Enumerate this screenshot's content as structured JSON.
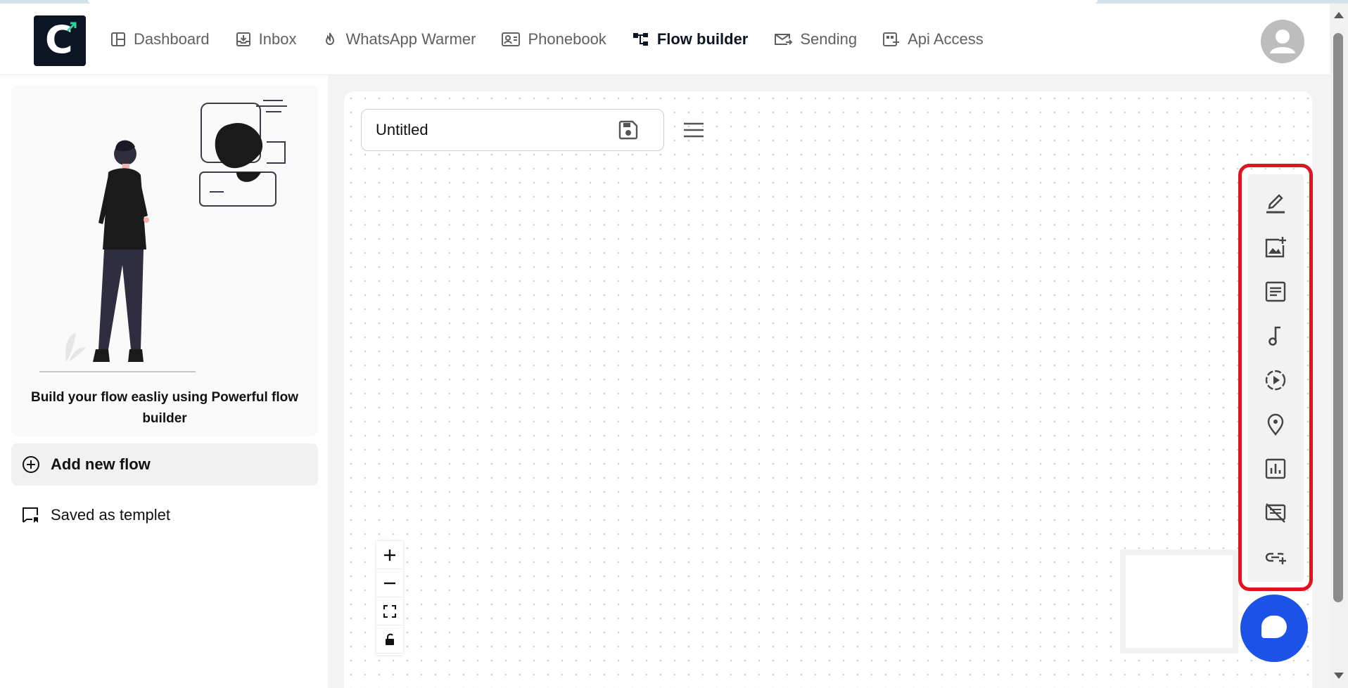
{
  "nav": {
    "items": [
      {
        "label": "Dashboard",
        "icon": "dashboard-icon"
      },
      {
        "label": "Inbox",
        "icon": "inbox-icon"
      },
      {
        "label": "WhatsApp Warmer",
        "icon": "flame-icon"
      },
      {
        "label": "Phonebook",
        "icon": "contact-card-icon"
      },
      {
        "label": "Flow builder",
        "icon": "flow-icon",
        "active": true
      },
      {
        "label": "Sending",
        "icon": "send-mail-icon"
      },
      {
        "label": "Api Access",
        "icon": "api-icon"
      }
    ]
  },
  "brand": {
    "logo_letter": "C",
    "primary": "#0c1524",
    "accent": "#2dd4a0"
  },
  "sidebar": {
    "promo_text": "Build your flow easliy using Powerful flow builder",
    "add_flow_label": "Add new flow",
    "saved_label": "Saved as templet"
  },
  "editor": {
    "flow_title": "Untitled"
  },
  "tools": [
    "text-edit-icon",
    "add-image-icon",
    "document-icon",
    "audio-icon",
    "video-play-icon",
    "location-icon",
    "chart-icon",
    "cancel-message-icon",
    "add-link-icon"
  ],
  "colors": {
    "highlight": "#e0141e",
    "chat_button": "#1c52e8"
  }
}
